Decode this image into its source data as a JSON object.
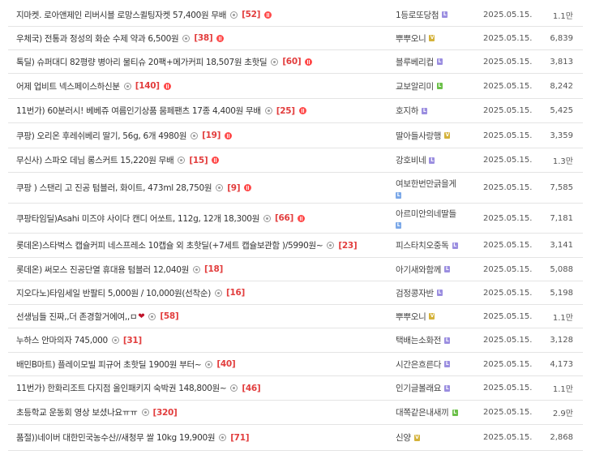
{
  "colors": {
    "level_purple": "#9b8ee0",
    "level_gold": "#d4b23a",
    "level_green": "#6cc04a",
    "level_blue": "#7ba8e8",
    "comment_count": "#e23d3d",
    "hot_badge": "#ff4a4a"
  },
  "posts": [
    {
      "title": "지마켓. 로아앤제인 리버시블 로망스퀼팅자켓 57,400원 무배",
      "comments": "[52]",
      "hot": true,
      "heart": "",
      "author": "1등로또당첨",
      "level": "purple",
      "date": "2025.05.15.",
      "views": "1.1만"
    },
    {
      "title": "우체국) 전통과 정성의 화순 수제 약과 6,500원",
      "comments": "[38]",
      "hot": true,
      "heart": "",
      "author": "뿌뿌오니",
      "level": "gold",
      "date": "2025.05.15.",
      "views": "6,839"
    },
    {
      "title": "톡딜) 슈퍼대디 82평량 병아리 물티슈 20팩+메가커피 18,507원 초핫딜",
      "comments": "[60]",
      "hot": true,
      "heart": "",
      "author": "블루베리컵",
      "level": "purple",
      "date": "2025.05.15.",
      "views": "3,813"
    },
    {
      "title": "어제 업비트 넥스페이스하신분",
      "comments": "[140]",
      "hot": true,
      "heart": "",
      "author": "교보알리미",
      "level": "green",
      "date": "2025.05.15.",
      "views": "8,242"
    },
    {
      "title": "11번가) 60분러시! 베베쥬 여름인기상품 뭄페팬츠 17종 4,400원 무배",
      "comments": "[25]",
      "hot": true,
      "heart": "",
      "author": "호지하",
      "level": "purple",
      "date": "2025.05.15.",
      "views": "5,425"
    },
    {
      "title": "쿠팡) 오리온 후레쉬베리 딸기, 56g, 6개 4980원",
      "comments": "[19]",
      "hot": true,
      "heart": "",
      "author": "딸아들사랑행",
      "level": "gold",
      "date": "2025.05.15.",
      "views": "3,359"
    },
    {
      "title": "무신사) 스파오 데님 롱스커트 15,220원 무배",
      "comments": "[15]",
      "hot": true,
      "heart": "",
      "author": "강호비네",
      "level": "purple",
      "date": "2025.05.15.",
      "views": "1.3만"
    },
    {
      "title": "쿠팡 ) 스탠리 고 진공 텀블러, 화이트, 473ml 28,750원",
      "comments": "[9]",
      "hot": true,
      "heart": "",
      "author": "여보한번만긁을게",
      "level": "blue",
      "date": "2025.05.15.",
      "views": "7,585"
    },
    {
      "title": "쿠팡타임딜)Asahi 미즈야 사이다 캔디 어쏘트, 112g, 12개 18,300원",
      "comments": "[66]",
      "hot": true,
      "heart": "",
      "author": "아르미안의네딸들",
      "level": "blue",
      "date": "2025.05.15.",
      "views": "7,181"
    },
    {
      "title": "롯데온)스타벅스 캡슐커피 네스프레소 10캡슐 외 초핫딜(+7세트 캡슐보관함 )/5990원~",
      "comments": "[23]",
      "hot": false,
      "heart": "",
      "author": "피스타치오중독",
      "level": "purple",
      "date": "2025.05.15.",
      "views": "3,141"
    },
    {
      "title": "롯데온) 써모스 진공단열 휴대용 텀블러 12,040원",
      "comments": "[18]",
      "hot": false,
      "heart": "",
      "author": "아기새와함께",
      "level": "purple",
      "date": "2025.05.15.",
      "views": "5,088"
    },
    {
      "title": "지오다노)타임세일 반팔티 5,000원 / 10,000원(선착순)",
      "comments": "[16]",
      "hot": false,
      "heart": "",
      "author": "검정콩자반",
      "level": "purple",
      "date": "2025.05.15.",
      "views": "5,198"
    },
    {
      "title": "선생님들 진짜,,더 존경할거에여,,ㅁ",
      "comments": "[58]",
      "hot": false,
      "heart": "❤",
      "author": "뿌뿌오니",
      "level": "gold",
      "date": "2025.05.15.",
      "views": "1.1만"
    },
    {
      "title": "누하스 안마의자 745,000",
      "comments": "[31]",
      "hot": false,
      "heart": "",
      "author": "택배는소화전",
      "level": "purple",
      "date": "2025.05.15.",
      "views": "3,128"
    },
    {
      "title": "배민B마트) 플레이모빌 피규어 초핫딜 1900원 부터~",
      "comments": "[40]",
      "hot": false,
      "heart": "",
      "author": "시간은흐른다",
      "level": "purple",
      "date": "2025.05.15.",
      "views": "4,173"
    },
    {
      "title": "11번가) 한화리조트 다지점 올인패키지 숙박권 148,800원~",
      "comments": "[46]",
      "hot": false,
      "heart": "",
      "author": "인기글볼래요",
      "level": "purple",
      "date": "2025.05.15.",
      "views": "1.1만"
    },
    {
      "title": "초등학교 운동회 영상 보셨나요ㅠㅠ",
      "comments": "[320]",
      "hot": false,
      "heart": "",
      "author": "대쪽같은내새끼",
      "level": "green",
      "date": "2025.05.15.",
      "views": "2.9만"
    },
    {
      "title": "품절))네이버 대한민국농수산//새청무 쌀 10kg 19,900원",
      "comments": "[71]",
      "hot": false,
      "heart": "",
      "author": "신양",
      "level": "gold",
      "date": "2025.05.15.",
      "views": "2,868"
    }
  ]
}
